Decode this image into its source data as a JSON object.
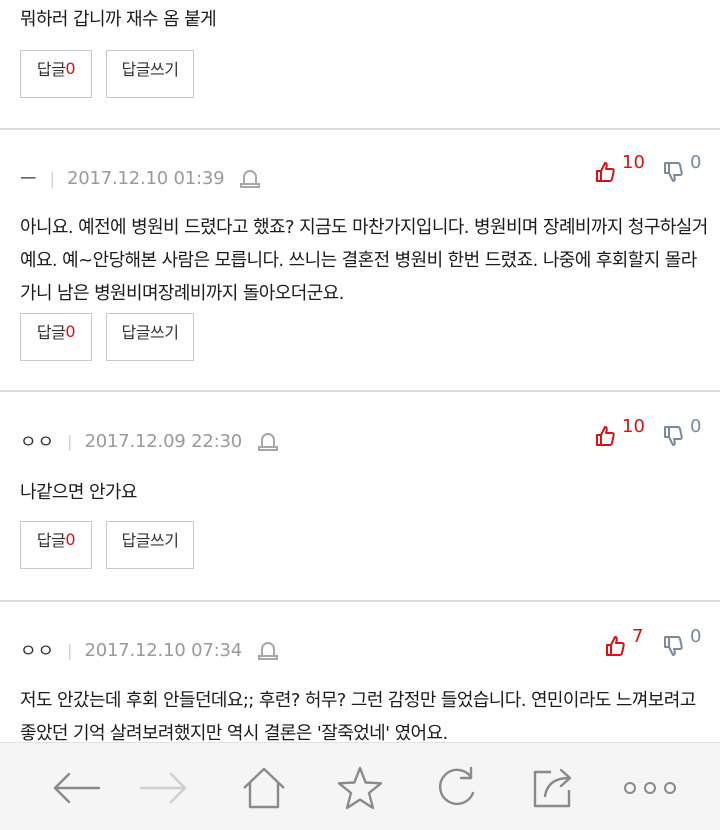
{
  "comments": [
    {
      "text": "뭐하러 갑니까 재수 옴 붙게",
      "reply_label": "답글",
      "reply_count": "0",
      "write_label": "답글쓰기"
    },
    {
      "author": "ㅡ",
      "date": "2017.12.10 01:39",
      "up": "10",
      "down": "0",
      "text": "아니요. 예전에 병원비 드렸다고 했죠? 지금도 마찬가지입니다. 병원비며 장례비까지 청구하실거예요. 예~안당해본 사람은 모릅니다. 쓰니는 결혼전 병원비 한번 드렸죠. 나중에 후회할지 몰라가니 남은 병원비며장례비까지 돌아오더군요.",
      "reply_label": "답글",
      "reply_count": "0",
      "write_label": "답글쓰기"
    },
    {
      "author": "ㅇㅇ",
      "date": "2017.12.09 22:30",
      "up": "10",
      "down": "0",
      "text": "나같으면 안가요",
      "reply_label": "답글",
      "reply_count": "0",
      "write_label": "답글쓰기"
    },
    {
      "author": "ㅇㅇ",
      "date": "2017.12.10 07:34",
      "up": "7",
      "down": "0",
      "text": "저도 안갔는데 후회 안들던데요;; 후련? 허무? 그런 감정만 들었습니다. 연민이라도 느껴보려고 좋았던 기억 살려보려했지만 역시 결론은 '잘죽었네' 였어요."
    }
  ],
  "toolbar": {
    "icons": [
      "back-arrow-icon",
      "forward-arrow-icon",
      "home-icon",
      "star-icon",
      "refresh-icon",
      "share-icon",
      "more-icon"
    ]
  },
  "colors": {
    "upvote": "#dd1111",
    "downvote": "#7a8a99",
    "divider": "#dcdcdc"
  }
}
